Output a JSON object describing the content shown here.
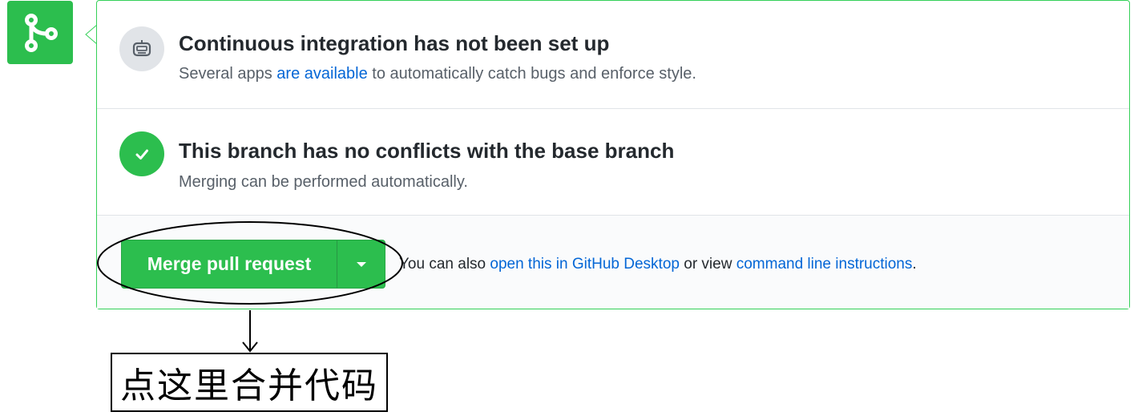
{
  "merge_box": {
    "ci": {
      "title": "Continuous integration has not been set up",
      "desc_before": "Several apps ",
      "desc_link": "are available",
      "desc_after": " to automatically catch bugs and enforce style."
    },
    "conflicts": {
      "title": "This branch has no conflicts with the base branch",
      "desc": "Merging can be performed automatically."
    },
    "merge": {
      "button_label": "Merge pull request",
      "alt_before": "You can also ",
      "desktop_link": "open this in GitHub Desktop",
      "alt_middle": " or view ",
      "cli_link": "command line instructions",
      "alt_after": "."
    }
  },
  "annotation": {
    "text": "点这里合并代码"
  },
  "colors": {
    "success_green": "#2cbe4e",
    "link_blue": "#0366d6",
    "border_green": "#34d058"
  },
  "icons": {
    "merge_badge": "git-merge-icon",
    "ci": "robot-icon",
    "conflicts": "check-icon",
    "dropdown": "triangle-down-icon"
  }
}
